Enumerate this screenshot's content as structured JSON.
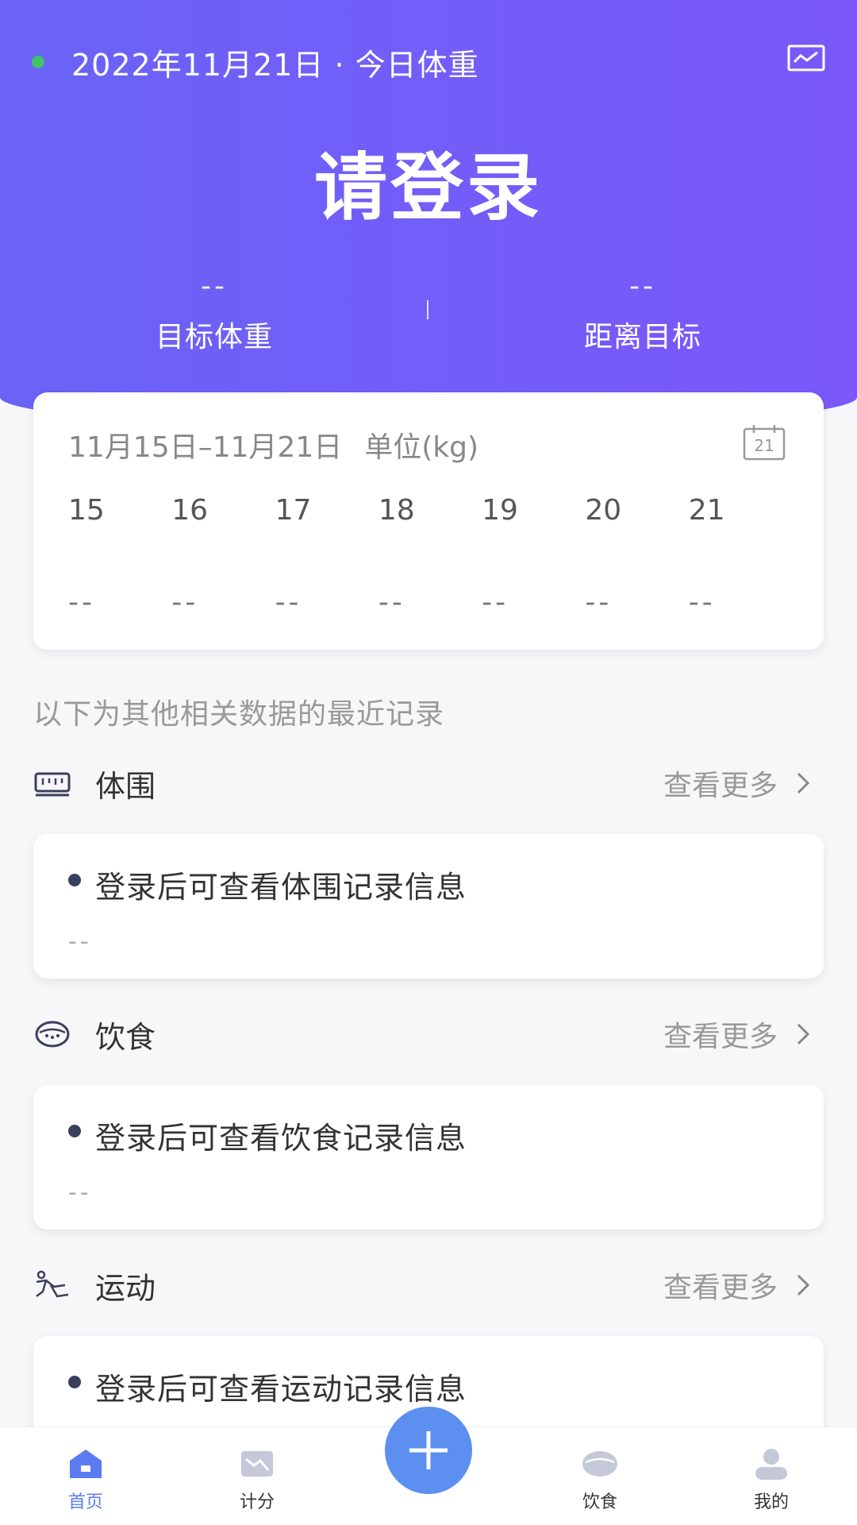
{
  "header": {
    "date_text": "2022年11月21日 · 今日体重",
    "login_title": "请登录",
    "target_weight": {
      "value": "--",
      "label": "目标体重"
    },
    "distance": {
      "value": "--",
      "label": "距离目标"
    }
  },
  "week": {
    "range": "11月15日–11月21日",
    "unit": "单位(kg)",
    "calendar_day": "21",
    "days": [
      "15",
      "16",
      "17",
      "18",
      "19",
      "20",
      "21"
    ],
    "values": [
      "--",
      "--",
      "--",
      "--",
      "--",
      "--",
      "--"
    ]
  },
  "hint": "以下为其他相关数据的最近记录",
  "sections": [
    {
      "title": "体围",
      "more": "查看更多",
      "record": "登录后可查看体围记录信息",
      "value": "--",
      "icon": "tape-measure-icon"
    },
    {
      "title": "饮食",
      "more": "查看更多",
      "record": "登录后可查看饮食记录信息",
      "value": "--",
      "icon": "food-bowl-icon"
    },
    {
      "title": "运动",
      "more": "查看更多",
      "record": "登录后可查看运动记录信息",
      "icon": "running-icon"
    }
  ],
  "nav": {
    "home": "首页",
    "score": "计分",
    "diet": "饮食",
    "mine": "我的"
  },
  "colors": {
    "header_start": "#6a63f6",
    "header_end": "#7a58fa",
    "accent": "#5c8ff0",
    "status_dot": "#43c26a"
  }
}
